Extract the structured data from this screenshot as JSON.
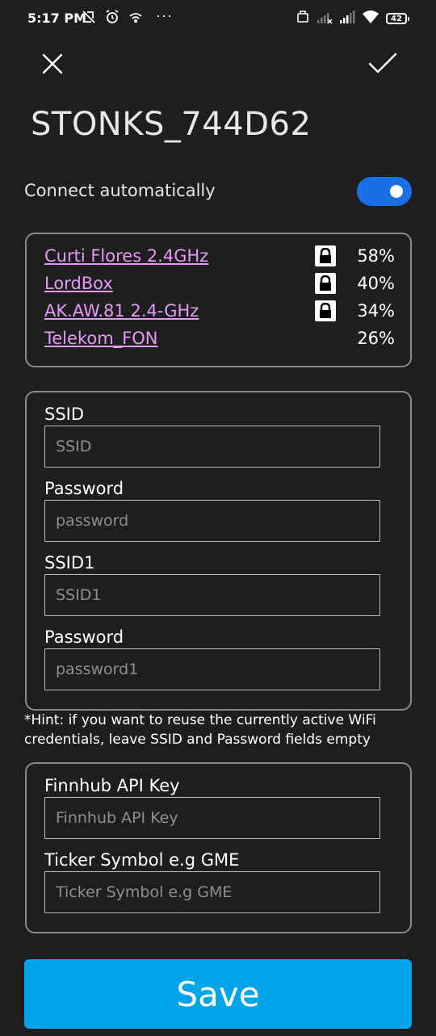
{
  "status_bar": {
    "time": "5:17 PM",
    "battery": "42"
  },
  "header": {
    "title": "STONKS_744D62"
  },
  "auto_connect": {
    "label": "Connect automatically",
    "enabled": true
  },
  "networks": [
    {
      "name": "Curti Flores 2.4GHz",
      "signal": "58%",
      "locked": true
    },
    {
      "name": "LordBox",
      "signal": "40%",
      "locked": true
    },
    {
      "name": "AK.AW.81 2.4-GHz",
      "signal": "34%",
      "locked": true
    },
    {
      "name": "Telekom_FON",
      "signal": "26%",
      "locked": false
    }
  ],
  "wifi_form": {
    "ssid_label": "SSID",
    "ssid_placeholder": "SSID",
    "password_label": "Password",
    "password_placeholder": "password",
    "ssid1_label": "SSID1",
    "ssid1_placeholder": "SSID1",
    "password1_label": "Password",
    "password1_placeholder": "password1"
  },
  "hint": "*Hint: if you want to reuse the currently active WiFi credentials, leave SSID and Password fields empty",
  "api_form": {
    "api_key_label": "Finnhub API Key",
    "api_key_placeholder": "Finnhub API Key",
    "ticker_label": "Ticker Symbol e.g GME",
    "ticker_placeholder": "Ticker Symbol e.g GME"
  },
  "save_label": "Save",
  "colors": {
    "background": "#1e1e1e",
    "toggle": "#1a6fe6",
    "link": "#e39af5",
    "save": "#02a4ea",
    "panel_border": "#8a8a8a"
  },
  "icons": {
    "close": "close-icon",
    "confirm": "check-icon",
    "lock": "lock-icon"
  }
}
